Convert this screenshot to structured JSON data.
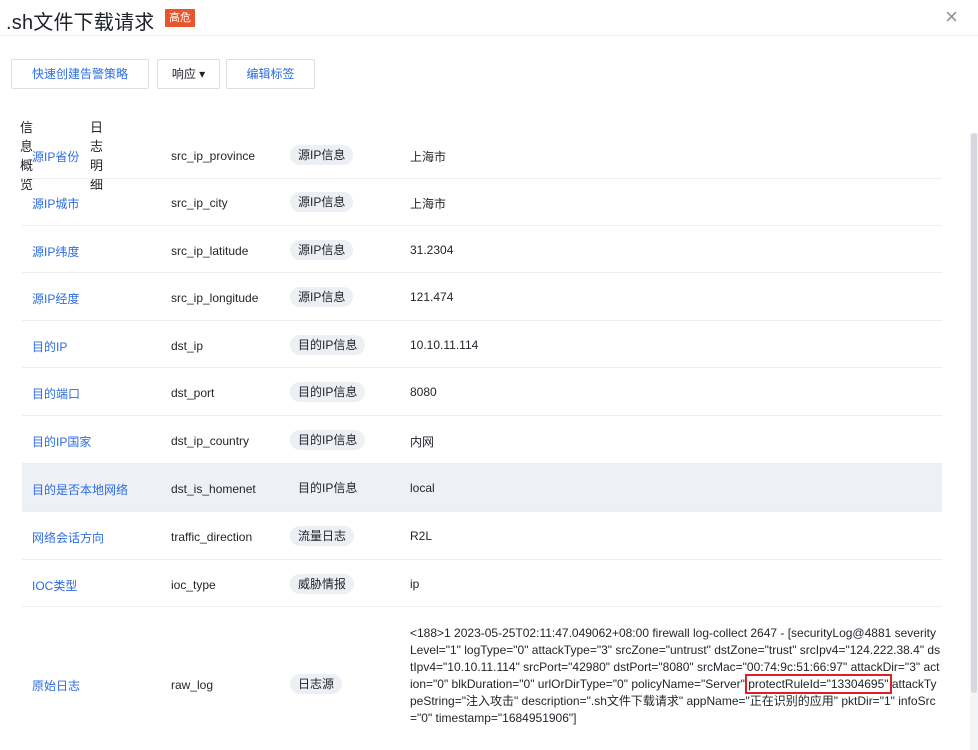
{
  "dialog": {
    "title": ".sh文件下载请求",
    "severity_badge": "高危",
    "close_icon": "close-icon",
    "close_glyph": "×"
  },
  "toolbar": {
    "quick_policy_label": "快速创建告警策略",
    "response_label": "响应 ▾",
    "edit_tags_label": "编辑标签"
  },
  "tabs": [
    "信息概览",
    "日志明细"
  ],
  "rows": [
    {
      "name": "源IP省份",
      "key": "src_ip_province",
      "tag": "源IP信息",
      "value": "上海市"
    },
    {
      "name": "源IP城市",
      "key": "src_ip_city",
      "tag": "源IP信息",
      "value": "上海市"
    },
    {
      "name": "源IP纬度",
      "key": "src_ip_latitude",
      "tag": "源IP信息",
      "value": "31.2304"
    },
    {
      "name": "源IP经度",
      "key": "src_ip_longitude",
      "tag": "源IP信息",
      "value": "121.474"
    },
    {
      "name": "目的IP",
      "key": "dst_ip",
      "tag": "目的IP信息",
      "value": "10.10.11.114"
    },
    {
      "name": "目的端口",
      "key": "dst_port",
      "tag": "目的IP信息",
      "value": "8080"
    },
    {
      "name": "目的IP国家",
      "key": "dst_ip_country",
      "tag": "目的IP信息",
      "value": "内网"
    },
    {
      "name": "目的是否本地网络",
      "key": "dst_is_homenet",
      "tag": "目的IP信息",
      "value": "local"
    },
    {
      "name": "网络会话方向",
      "key": "traffic_direction",
      "tag": "流量日志",
      "value": "R2L"
    },
    {
      "name": "IOC类型",
      "key": "ioc_type",
      "tag": "威胁情报",
      "value": "ip"
    },
    {
      "name": "原始日志",
      "key": "raw_log",
      "tag": "日志源",
      "value_before": "<188>1 2023-05-25T02:11:47.049062+08:00 firewall log-collect 2647 - [securityLog@4881 severityLevel=\"1\" logType=\"0\" attackType=\"3\" srcZone=\"untrust\" dstZone=\"trust\" srcIpv4=\"124.222.38.4\" dstIpv4=\"10.10.11.114\" srcPort=\"42980\" dstPort=\"8080\" srcMac=\"00:74:9c:51:66:97\" attackDir=\"3\" action=\"0\" blkDuration=\"0\" urlOrDirType=\"0\" policyName=\"Server\" ",
      "value_marked": "protectRuleId=\"13304695\"",
      "value_after": " attackTypeString=\"注入攻击\" description=\".sh文件下载请求\" appName=\"正在识别的应用\" pktDir=\"1\" infoSrc=\"0\" timestamp=\"1684951906\"]"
    }
  ]
}
